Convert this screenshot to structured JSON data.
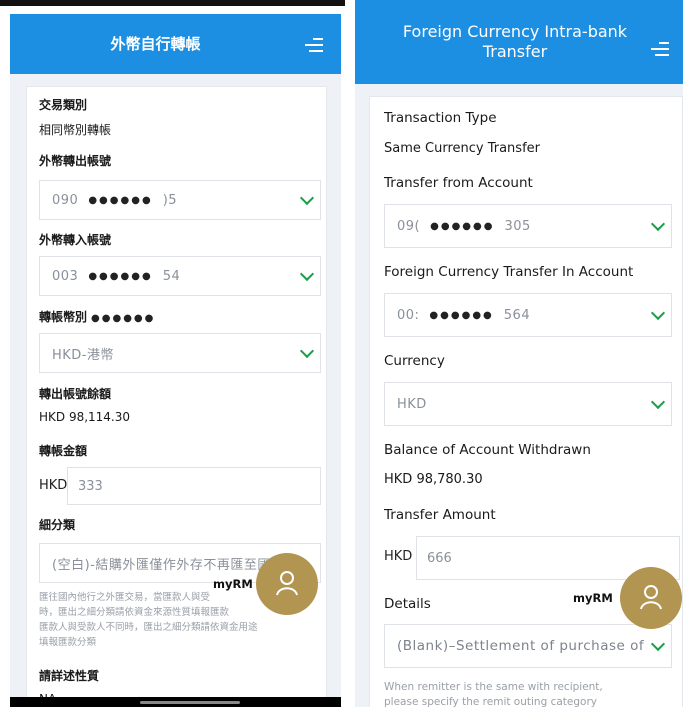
{
  "left": {
    "header_title": "外幣自行轉帳",
    "transaction_type_label": "交易類別",
    "transaction_type_value": "相同幣別轉帳",
    "from_account_label": "外幣轉出帳號",
    "from_account_prefix": "090",
    "from_account_masked": "●●●●●●",
    "from_account_suffix": ")5",
    "to_account_label": "外幣轉入帳號",
    "to_account_prefix": "003",
    "to_account_masked": "●●●●●●",
    "to_account_suffix": "54",
    "currency_label": "轉帳幣別",
    "currency_label_masked": "●●●●●●",
    "currency_value": "HKD-港幣",
    "balance_label": "轉出帳號餘額",
    "balance_value": "HKD 98,114.30",
    "amount_label": "轉帳金額",
    "amount_currency": "HKD",
    "amount_value": "333",
    "details_label": "細分類",
    "details_value": "(空白)-結購外匯僅作外存不再匯至國",
    "note_line1": "匯往國內他行之外匯交易，當匯款人與受",
    "note_line2": "時，匯出之細分類請依資金來源性質填報匯款",
    "note_line3": "匯款人與受款人不同時，匯出之細分類請依資金用途",
    "note_line4": "填報匯款分類",
    "nature_label": "請詳述性質",
    "nature_value": "NA",
    "fab_label": "myRM"
  },
  "right": {
    "header_title": "Foreign Currency Intra-bank Transfer",
    "transaction_type_label": "Transaction Type",
    "transaction_type_value": "Same Currency Transfer",
    "from_account_label": "Transfer from Account",
    "from_account_prefix": "09(",
    "from_account_masked": "●●●●●●",
    "from_account_suffix": "305",
    "to_account_label": "Foreign Currency Transfer In Account",
    "to_account_prefix": "00:",
    "to_account_masked": "●●●●●●",
    "to_account_suffix": "564",
    "currency_label": "Currency",
    "currency_value": "HKD",
    "balance_label": "Balance of Account Withdrawn",
    "balance_value": "HKD 98,780.30",
    "amount_label": "Transfer Amount",
    "amount_currency": "HKD",
    "amount_value": "666",
    "details_label": "Details",
    "details_value": "(Blank)–Settlement of purchase of fo",
    "note_line1": "When remitter is the same with recipient,",
    "note_line2": "please specify the remit outing category",
    "fab_label": "myRM"
  },
  "colors": {
    "header_blue": "#1d8fe3",
    "chevron_green": "#1a9e4a",
    "fab_gold": "#b39552"
  }
}
